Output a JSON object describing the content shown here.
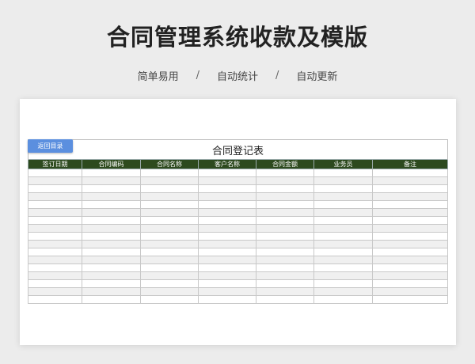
{
  "header": {
    "title": "合同管理系统收款及模版",
    "features": [
      "简单易用",
      "自动统计",
      "自动更新"
    ],
    "separator": "/"
  },
  "sheet": {
    "back_button": "返回目录",
    "table_title": "合同登记表",
    "columns": [
      "签订日期",
      "合同编码",
      "合同名称",
      "客户名称",
      "合同金额",
      "业务员",
      "备注"
    ],
    "rows": [
      [
        "",
        "",
        "",
        "",
        "",
        "",
        ""
      ],
      [
        "",
        "",
        "",
        "",
        "",
        "",
        ""
      ],
      [
        "",
        "",
        "",
        "",
        "",
        "",
        ""
      ],
      [
        "",
        "",
        "",
        "",
        "",
        "",
        ""
      ],
      [
        "",
        "",
        "",
        "",
        "",
        "",
        ""
      ],
      [
        "",
        "",
        "",
        "",
        "",
        "",
        ""
      ],
      [
        "",
        "",
        "",
        "",
        "",
        "",
        ""
      ],
      [
        "",
        "",
        "",
        "",
        "",
        "",
        ""
      ],
      [
        "",
        "",
        "",
        "",
        "",
        "",
        ""
      ],
      [
        "",
        "",
        "",
        "",
        "",
        "",
        ""
      ],
      [
        "",
        "",
        "",
        "",
        "",
        "",
        ""
      ],
      [
        "",
        "",
        "",
        "",
        "",
        "",
        ""
      ],
      [
        "",
        "",
        "",
        "",
        "",
        "",
        ""
      ],
      [
        "",
        "",
        "",
        "",
        "",
        "",
        ""
      ],
      [
        "",
        "",
        "",
        "",
        "",
        "",
        ""
      ],
      [
        "",
        "",
        "",
        "",
        "",
        "",
        ""
      ],
      [
        "",
        "",
        "",
        "",
        "",
        "",
        ""
      ]
    ]
  },
  "colors": {
    "header_bg": "#2d4a1e",
    "button_bg": "#5b8fdf"
  }
}
